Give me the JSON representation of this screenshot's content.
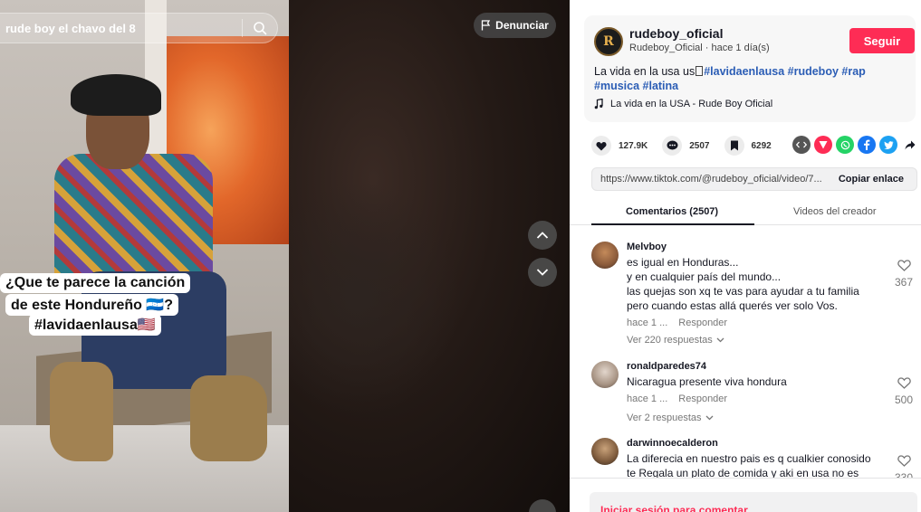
{
  "search": {
    "query": "rude boy el chavo del 8"
  },
  "video": {
    "report_label": "Denunciar",
    "caption_lines": [
      "¿Que te parece la canción",
      "de este Hondureño 🇭🇳?",
      "#lavidaenlausa🇺🇸"
    ]
  },
  "author": {
    "avatar_initial": "R",
    "username": "rudeboy_oficial",
    "nickname": "Rudeboy_Oficial",
    "separator": "·",
    "posted": "hace 1 día(s)",
    "follow_label": "Seguir"
  },
  "description": {
    "text": "La vida en la usa us",
    "tags": [
      "#lavidaenlausa",
      "#rudeboy",
      "#rap",
      "#musica",
      "#latina"
    ]
  },
  "music": {
    "title": "La vida en la USA - Rude Boy Oficial"
  },
  "stats": {
    "likes": "127.9K",
    "comments": "2507",
    "saves": "6292"
  },
  "share": {
    "link": "https://www.tiktok.com/@rudeboy_oficial/video/7...",
    "copy_label": "Copiar enlace"
  },
  "tabs": {
    "comments": "Comentarios (2507)",
    "creator_videos": "Videos del creador"
  },
  "comments": [
    {
      "user": "Melvboy",
      "text": "es igual en Honduras...\ny en cualquier país del mundo...\nlas quejas son xq te vas para ayudar a tu familia\npero cuando estas allá querés ver solo Vos.",
      "time": "hace 1 ...",
      "reply_label": "Responder",
      "replies_label": "Ver 220 respuestas",
      "likes": "367"
    },
    {
      "user": "ronaldparedes74",
      "text": "Nicaragua presente viva hondura",
      "time": "hace 1 ...",
      "reply_label": "Responder",
      "replies_label": "Ver 2 respuestas",
      "likes": "500"
    },
    {
      "user": "darwinnoecalderon",
      "text": "La diferecia en nuestro pais es q cualkier conosido\nte Regala un plato de comida y aki en usa no es asi",
      "likes": "330"
    }
  ],
  "login": {
    "label": "Iniciar sesión para comentar"
  },
  "colors": {
    "accent": "#fe2c55",
    "hashtag": "#2b5db5",
    "text": "#161823"
  }
}
